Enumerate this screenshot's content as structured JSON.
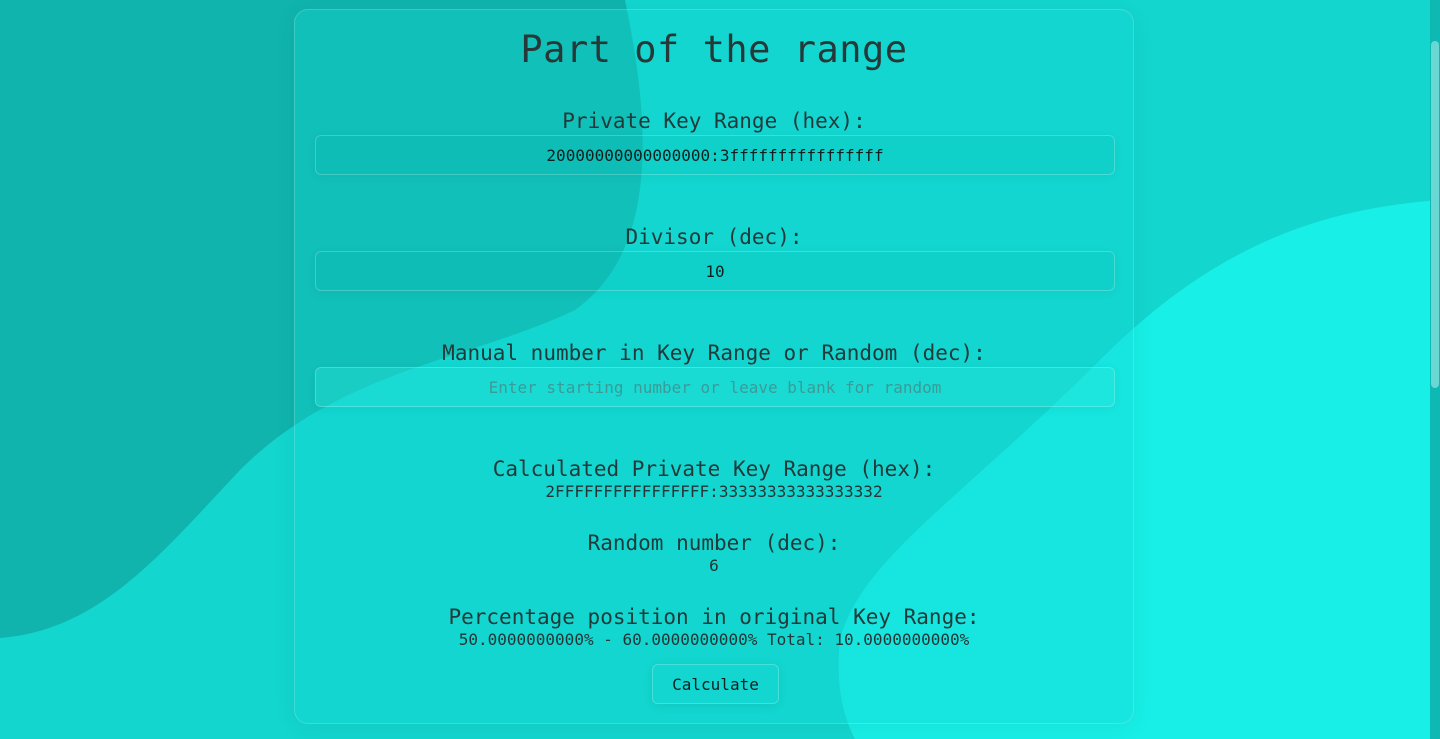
{
  "page": {
    "title": "Part of the range"
  },
  "colors": {
    "background": "#13d6cf",
    "dark_blob": "#10b4ad",
    "light_blob": "#18efe6",
    "text": "#223a3a"
  },
  "form": {
    "key_range_label": "Private Key Range (hex):",
    "key_range_value": "20000000000000000:3ffffffffffffffff",
    "divisor_label": "Divisor (dec):",
    "divisor_value": "10",
    "manual_label": "Manual number in Key Range or Random (dec):",
    "manual_value": "",
    "manual_placeholder": "Enter starting number or leave blank for random"
  },
  "results": {
    "calculated_label": "Calculated Private Key Range (hex):",
    "calculated_value": "2FFFFFFFFFFFFFFFF:33333333333333332",
    "random_label": "Random number (dec):",
    "random_value": "6",
    "percentage_label": "Percentage position in original Key Range:",
    "percentage_value": "50.0000000000% - 60.0000000000% Total: 10.0000000000%"
  },
  "actions": {
    "calculate_label": "Calculate"
  }
}
